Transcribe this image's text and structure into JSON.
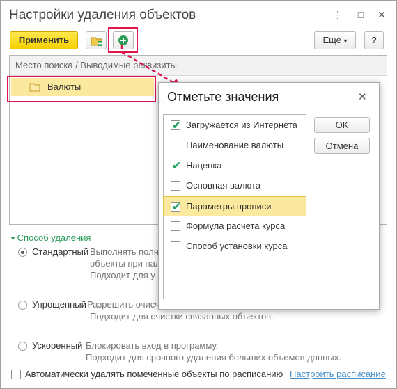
{
  "window": {
    "title": "Настройки удаления объектов",
    "controls": {
      "more": "⋮",
      "maximize": "□",
      "close": "✕"
    }
  },
  "toolbar": {
    "apply_label": "Применить",
    "more_label": "Еще",
    "more_arrow": "▾",
    "help_label": "?"
  },
  "list": {
    "header": "Место поиска / Выводимые реквизиты",
    "rows": [
      {
        "label": "Валюты"
      }
    ]
  },
  "delete_method": {
    "section_label": "Способ удаления",
    "options": [
      {
        "label": "Стандартный",
        "selected": true,
        "line1": "Выполнять полнт",
        "line2": "объекты при нал",
        "line3": "Подходит для у"
      },
      {
        "label": "Упрощенный",
        "selected": false,
        "line1": "Разрешить очисч",
        "line2": "Подходит для очистки связанных объектов."
      },
      {
        "label": "Ускоренный",
        "selected": false,
        "line1": "Блокировать вход в программу.",
        "line2": "Подходит для срочного удаления больших объемов данных."
      }
    ]
  },
  "schedule": {
    "checkbox_label": "Автоматически удалять помеченные объекты по расписанию",
    "checked": false,
    "link_label": "Настроить расписание"
  },
  "dialog": {
    "title": "Отметьте значения",
    "close": "✕",
    "ok_label": "OK",
    "cancel_label": "Отмена",
    "items": [
      {
        "label": "Загружается из Интернета",
        "checked": true
      },
      {
        "label": "Наименование валюты",
        "checked": false
      },
      {
        "label": "Наценка",
        "checked": true
      },
      {
        "label": "Основная валюта",
        "checked": false
      },
      {
        "label": "Параметры прописи",
        "checked": true,
        "selected": true
      },
      {
        "label": "Формула расчета курса",
        "checked": false
      },
      {
        "label": "Способ установки курса",
        "checked": false
      }
    ]
  },
  "colors": {
    "accent_yellow": "#f5cf00",
    "highlight_red": "#e0154e",
    "green": "#27a36a"
  }
}
